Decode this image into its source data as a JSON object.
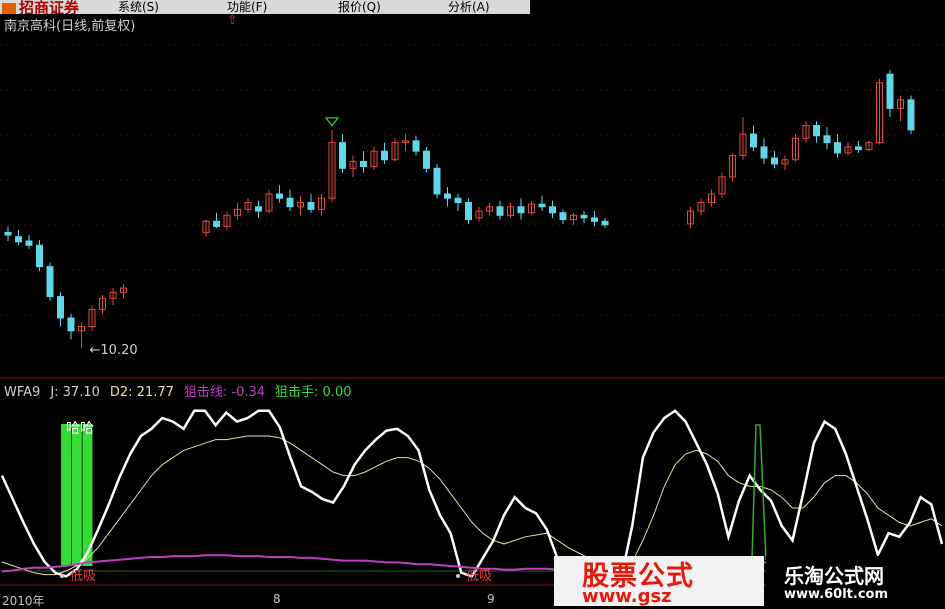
{
  "menubar": {
    "logo_text": "招商证券",
    "items": [
      "系统(S)",
      "功能(F)",
      "报价(Q)",
      "分析(A)"
    ]
  },
  "stock_title": "南京高科(日线,前复权)",
  "low_price_label": "←10.20",
  "indicator": {
    "name": "WFA9",
    "j_label": "J: 37.10",
    "d2_label": "D2: 21.77",
    "line1_label": "狙击线: -0.34",
    "line2_label": "狙击手: 0.00",
    "text_haha": "哈哈",
    "text_dixi": "低吸"
  },
  "x_axis_labels": [
    "2010年",
    "8",
    "9"
  ],
  "watermark": {
    "brand_text": "股票公式",
    "brand_url": "www.gsz",
    "site_name": "乐淘公式网",
    "site_url": "www.60lt.com"
  },
  "colors": {
    "up": "#e24a3a",
    "down": "#5fd7e8",
    "j_line": "#ffffff",
    "d_line": "#e8e0a0",
    "purple": "#c040c0",
    "signal": "#33dd33",
    "pane_border": "#8a1010"
  },
  "chart_data": [
    {
      "type": "candlestick",
      "title": "南京高科(日线,前复权)",
      "annotations": [
        "←10.20"
      ],
      "series": [
        {
          "values": [
            [
              11.55,
              11.62,
              11.45,
              11.52
            ],
            [
              11.5,
              11.58,
              11.4,
              11.44
            ],
            [
              11.45,
              11.52,
              11.36,
              11.4
            ],
            [
              11.4,
              11.46,
              11.1,
              11.15
            ],
            [
              11.15,
              11.2,
              10.75,
              10.8
            ],
            [
              10.8,
              10.85,
              10.45,
              10.55
            ],
            [
              10.55,
              10.6,
              10.3,
              10.4
            ],
            [
              10.4,
              10.5,
              10.2,
              10.45
            ],
            [
              10.45,
              10.7,
              10.4,
              10.65
            ],
            [
              10.65,
              10.82,
              10.6,
              10.78
            ],
            [
              10.78,
              10.9,
              10.7,
              10.85
            ],
            [
              10.85,
              10.95,
              10.78,
              10.9
            ],
            [
              11.55,
              11.7,
              11.5,
              11.68
            ],
            [
              11.68,
              11.78,
              11.6,
              11.62
            ],
            [
              11.62,
              11.8,
              11.58,
              11.75
            ],
            [
              11.75,
              11.9,
              11.7,
              11.82
            ],
            [
              11.82,
              11.95,
              11.78,
              11.9
            ],
            [
              11.85,
              11.92,
              11.72,
              11.8
            ],
            [
              11.8,
              12.05,
              11.78,
              12.0
            ],
            [
              12.0,
              12.1,
              11.9,
              11.95
            ],
            [
              11.95,
              12.05,
              11.8,
              11.85
            ],
            [
              11.85,
              11.98,
              11.75,
              11.9
            ],
            [
              11.9,
              12.0,
              11.78,
              11.82
            ],
            [
              11.82,
              12.0,
              11.75,
              11.95
            ],
            [
              11.95,
              12.75,
              11.9,
              12.6
            ],
            [
              12.6,
              12.7,
              12.25,
              12.3
            ],
            [
              12.3,
              12.45,
              12.2,
              12.38
            ],
            [
              12.38,
              12.5,
              12.25,
              12.32
            ],
            [
              12.32,
              12.55,
              12.28,
              12.5
            ],
            [
              12.5,
              12.6,
              12.35,
              12.4
            ],
            [
              12.4,
              12.65,
              12.38,
              12.6
            ],
            [
              12.6,
              12.7,
              12.5,
              12.62
            ],
            [
              12.62,
              12.68,
              12.45,
              12.5
            ],
            [
              12.5,
              12.55,
              12.25,
              12.3
            ],
            [
              12.3,
              12.35,
              11.95,
              12.0
            ],
            [
              12.0,
              12.08,
              11.85,
              11.95
            ],
            [
              11.95,
              12.0,
              11.8,
              11.9
            ],
            [
              11.9,
              11.95,
              11.65,
              11.7
            ],
            [
              11.72,
              11.85,
              11.68,
              11.8
            ],
            [
              11.8,
              11.9,
              11.75,
              11.85
            ],
            [
              11.85,
              11.92,
              11.7,
              11.75
            ],
            [
              11.75,
              11.9,
              11.72,
              11.85
            ],
            [
              11.85,
              11.95,
              11.7,
              11.78
            ],
            [
              11.78,
              11.92,
              11.75,
              11.88
            ],
            [
              11.88,
              11.98,
              11.8,
              11.85
            ],
            [
              11.85,
              11.92,
              11.72,
              11.78
            ],
            [
              11.78,
              11.82,
              11.65,
              11.7
            ],
            [
              11.7,
              11.78,
              11.64,
              11.75
            ],
            [
              11.75,
              11.8,
              11.66,
              11.72
            ],
            [
              11.72,
              11.8,
              11.62,
              11.68
            ],
            [
              11.68,
              11.72,
              11.6,
              11.64
            ],
            [
              11.65,
              11.85,
              11.6,
              11.8
            ],
            [
              11.8,
              11.95,
              11.75,
              11.9
            ],
            [
              11.9,
              12.05,
              11.85,
              12.0
            ],
            [
              12.0,
              12.25,
              11.95,
              12.2
            ],
            [
              12.2,
              12.48,
              12.15,
              12.45
            ],
            [
              12.45,
              12.9,
              12.4,
              12.7
            ],
            [
              12.7,
              12.8,
              12.5,
              12.55
            ],
            [
              12.55,
              12.65,
              12.35,
              12.42
            ],
            [
              12.42,
              12.5,
              12.3,
              12.35
            ],
            [
              12.35,
              12.45,
              12.28,
              12.4
            ],
            [
              12.4,
              12.7,
              12.38,
              12.65
            ],
            [
              12.65,
              12.85,
              12.6,
              12.8
            ],
            [
              12.8,
              12.85,
              12.6,
              12.68
            ],
            [
              12.68,
              12.78,
              12.52,
              12.6
            ],
            [
              12.6,
              12.7,
              12.42,
              12.48
            ],
            [
              12.48,
              12.6,
              12.45,
              12.55
            ],
            [
              12.55,
              12.62,
              12.48,
              12.52
            ],
            [
              12.52,
              12.62,
              12.5,
              12.6
            ],
            [
              12.6,
              13.35,
              12.58,
              13.3
            ],
            [
              13.4,
              13.45,
              12.9,
              13.0
            ],
            [
              13.0,
              13.15,
              12.85,
              13.1
            ],
            [
              13.1,
              13.15,
              12.7,
              12.75
            ]
          ]
        }
      ]
    },
    {
      "type": "line",
      "title": "WFA9",
      "series": [
        {
          "name": "J",
          "values": [
            58,
            45,
            32,
            20,
            10,
            4,
            2,
            6,
            15,
            28,
            42,
            57,
            70,
            80,
            84,
            90,
            88,
            84,
            94,
            94,
            86,
            93,
            88,
            90,
            94,
            94,
            85,
            68,
            52,
            49,
            45,
            43,
            52,
            64,
            72,
            78,
            83,
            84,
            80,
            72,
            50,
            36,
            26,
            4,
            2,
            12,
            22,
            36,
            46,
            40,
            37,
            28,
            12,
            7,
            9,
            8,
            4,
            3,
            2,
            30,
            68,
            82,
            90,
            94,
            88,
            76,
            64,
            48,
            24,
            44,
            58,
            50,
            44,
            30,
            22,
            48,
            76,
            88,
            84,
            70,
            52,
            34,
            14,
            26,
            24,
            32,
            46,
            42,
            20
          ]
        },
        {
          "name": "D2",
          "values": [
            10,
            8,
            6,
            4,
            3,
            3,
            5,
            8,
            12,
            18,
            26,
            34,
            42,
            50,
            58,
            64,
            68,
            72,
            74,
            76,
            78,
            78,
            79,
            80,
            80,
            80,
            79,
            76,
            72,
            68,
            64,
            60,
            58,
            58,
            60,
            63,
            66,
            68,
            68,
            66,
            62,
            56,
            48,
            40,
            32,
            26,
            22,
            20,
            22,
            24,
            25,
            26,
            22,
            18,
            15,
            12,
            10,
            8,
            7,
            10,
            22,
            36,
            52,
            64,
            70,
            72,
            70,
            66,
            58,
            54,
            52,
            52,
            50,
            46,
            40,
            40,
            46,
            54,
            58,
            58,
            54,
            48,
            40,
            36,
            32,
            30,
            32,
            34,
            30
          ]
        },
        {
          "name": "狙击线",
          "values": [
            -0.6,
            -0.5,
            -0.3,
            -0.2,
            -0.2,
            -0.1,
            0.0,
            0.2,
            0.4,
            0.5,
            0.6,
            0.7,
            0.8,
            0.9,
            1.0,
            1.0,
            1.1,
            1.1,
            1.1,
            1.2,
            1.2,
            1.2,
            1.1,
            1.1,
            1.1,
            1.0,
            1.0,
            1.0,
            0.9,
            0.9,
            0.8,
            0.7,
            0.6,
            0.6,
            0.6,
            0.5,
            0.4,
            0.4,
            0.3,
            0.2,
            0.2,
            0.1,
            0.0,
            -0.1,
            -0.2,
            -0.3,
            -0.3,
            -0.4,
            -0.4,
            -0.3,
            -0.3,
            -0.3,
            -0.4,
            -0.4,
            -0.4,
            -0.4,
            -0.4,
            -0.3,
            -0.3,
            -0.3,
            -0.2,
            -0.2,
            -0.1,
            -0.1,
            -0.1,
            0.1,
            0.3,
            0.5,
            0.6,
            0.5,
            0.5,
            0.4,
            0.4,
            0.3,
            0.3,
            0.2,
            0.2,
            0.1,
            0.0,
            -0.1,
            -0.1,
            -0.2,
            -0.2,
            -0.2,
            -0.3,
            0.2,
            0.5,
            0.2,
            -0.2
          ]
        },
        {
          "name": "狙击手",
          "values": [
            0,
            0,
            0,
            0,
            0,
            0,
            1,
            1,
            1,
            0,
            0,
            0,
            0,
            0,
            0,
            0,
            0,
            0,
            0,
            0,
            0,
            0,
            0,
            0,
            0,
            0,
            0,
            0,
            0,
            0,
            0,
            0,
            0,
            0,
            0,
            0,
            0,
            0,
            0,
            0,
            0,
            0,
            0,
            0,
            0,
            0,
            0,
            0,
            0,
            0,
            0,
            0,
            0,
            0,
            0,
            0,
            0,
            0,
            0,
            0,
            0,
            0,
            0,
            0,
            0,
            0,
            0,
            0,
            0,
            0,
            0,
            0,
            0,
            0,
            0,
            0,
            0,
            0,
            0,
            0,
            0,
            0,
            0,
            0,
            0,
            0,
            0,
            0,
            0
          ]
        }
      ]
    }
  ]
}
